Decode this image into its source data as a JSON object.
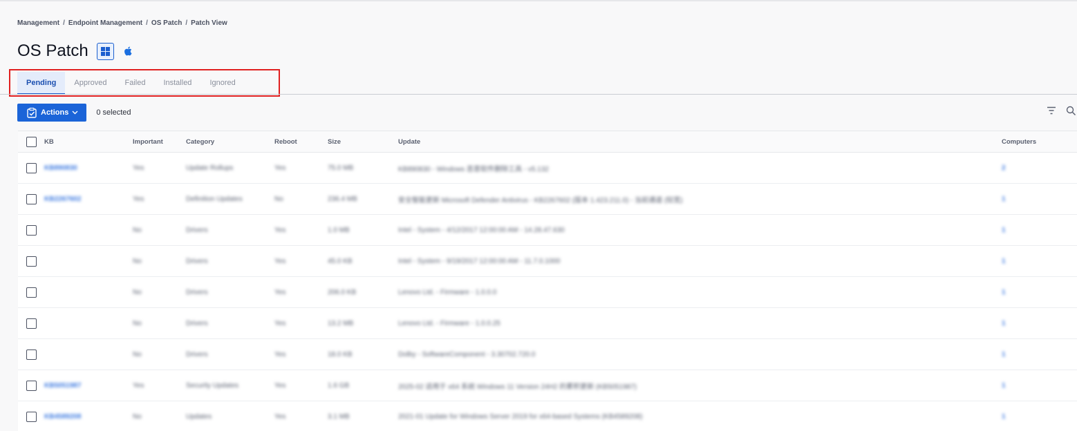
{
  "breadcrumb": [
    "Management",
    "Endpoint Management",
    "OS Patch",
    "Patch View"
  ],
  "breadcrumb_separator": "/",
  "page_title": "OS Patch",
  "os_filters": [
    {
      "icon": "windows-icon",
      "selected": true
    },
    {
      "icon": "apple-icon",
      "selected": false
    }
  ],
  "tabs": [
    {
      "label": "Pending",
      "active": true
    },
    {
      "label": "Approved",
      "active": false
    },
    {
      "label": "Failed",
      "active": false
    },
    {
      "label": "Installed",
      "active": false
    },
    {
      "label": "Ignored",
      "active": false
    }
  ],
  "toolbar": {
    "actions_label": "Actions",
    "selected_text": "0 selected",
    "accent_color": "#1b64d8"
  },
  "table": {
    "headers": {
      "kb": "KB",
      "important": "Important",
      "category": "Category",
      "reboot": "Reboot",
      "size": "Size",
      "update": "Update",
      "computers": "Computers"
    },
    "rows": [
      {
        "kb": "KB890830",
        "important": "Yes",
        "category": "Update Rollups",
        "reboot": "Yes",
        "size": "75.0 MB",
        "update": "KB890830 - Windows 恶意软件删除工具 - v5.132",
        "computers": "2"
      },
      {
        "kb": "KB2267602",
        "important": "Yes",
        "category": "Definition Updates",
        "reboot": "No",
        "size": "236.4 MB",
        "update": "安全智能更新 Microsoft Defender Antivirus - KB2267602 (版本 1.423.211.0) - 当前通道 (较宽)",
        "computers": "1"
      },
      {
        "kb": "",
        "important": "No",
        "category": "Drivers",
        "reboot": "Yes",
        "size": "1.0 MB",
        "update": "Intel - System - 4/12/2017 12:00:00 AM - 14.28.47.630",
        "computers": "1"
      },
      {
        "kb": "",
        "important": "No",
        "category": "Drivers",
        "reboot": "Yes",
        "size": "45.0 KB",
        "update": "Intel - System - 9/19/2017 12:00:00 AM - 11.7.0.1000",
        "computers": "1"
      },
      {
        "kb": "",
        "important": "No",
        "category": "Drivers",
        "reboot": "Yes",
        "size": "206.0 KB",
        "update": "Lenovo Ltd. - Firmware - 1.0.0.0",
        "computers": "1"
      },
      {
        "kb": "",
        "important": "No",
        "category": "Drivers",
        "reboot": "Yes",
        "size": "13.2 MB",
        "update": "Lenovo Ltd. - Firmware - 1.0.0.25",
        "computers": "1"
      },
      {
        "kb": "",
        "important": "No",
        "category": "Drivers",
        "reboot": "Yes",
        "size": "18.0 KB",
        "update": "Dolby - SoftwareComponent - 3.30702.720.0",
        "computers": "1"
      },
      {
        "kb": "KB5051987",
        "important": "Yes",
        "category": "Security Updates",
        "reboot": "Yes",
        "size": "1.6 GB",
        "update": "2025-02 适用于 x64 系统 Windows 11 Version 24H2 的累积更新 (KB5051987)",
        "computers": "1"
      },
      {
        "kb": "KB4589208",
        "important": "No",
        "category": "Updates",
        "reboot": "Yes",
        "size": "3.1 MB",
        "update": "2021-01 Update for Windows Server 2019 for x64-based Systems (KB4589208)",
        "computers": "1"
      }
    ]
  }
}
